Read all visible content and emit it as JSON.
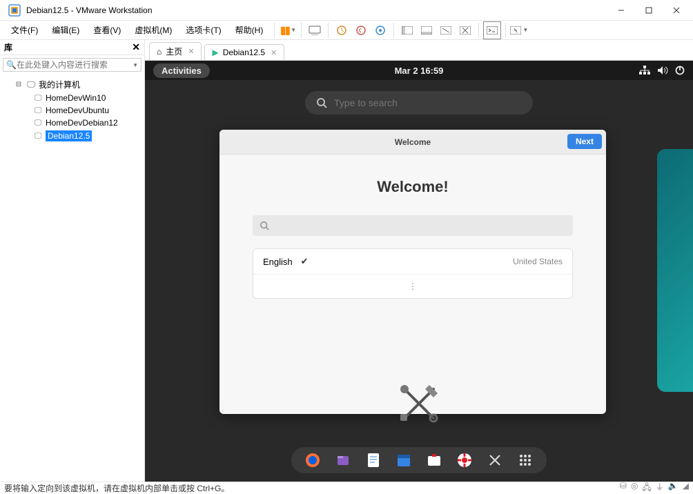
{
  "window": {
    "title": "Debian12.5  - VMware Workstation"
  },
  "menu": {
    "file": "文件(F)",
    "edit": "编辑(E)",
    "view": "查看(V)",
    "vm": "虚拟机(M)",
    "tabs": "选项卡(T)",
    "help": "帮助(H)"
  },
  "library": {
    "title": "库",
    "search_placeholder": "在此处键入内容进行搜索",
    "root": "我的计算机",
    "items": [
      {
        "label": "HomeDevWin10"
      },
      {
        "label": "HomeDevUbuntu"
      },
      {
        "label": "HomeDevDebian12"
      },
      {
        "label": "Debian12.5"
      }
    ]
  },
  "tabs": {
    "home": "主页",
    "vm": "Debian12.5"
  },
  "gnome": {
    "activities": "Activities",
    "clock": "Mar 2   16:59",
    "search_placeholder": "Type to search"
  },
  "welcome": {
    "header": "Welcome",
    "next": "Next",
    "title": "Welcome!",
    "lang": "English",
    "country": "United States"
  },
  "statusbar": {
    "hint": "要将输入定向到该虚拟机，请在虚拟机内部单击或按 Ctrl+G。"
  }
}
